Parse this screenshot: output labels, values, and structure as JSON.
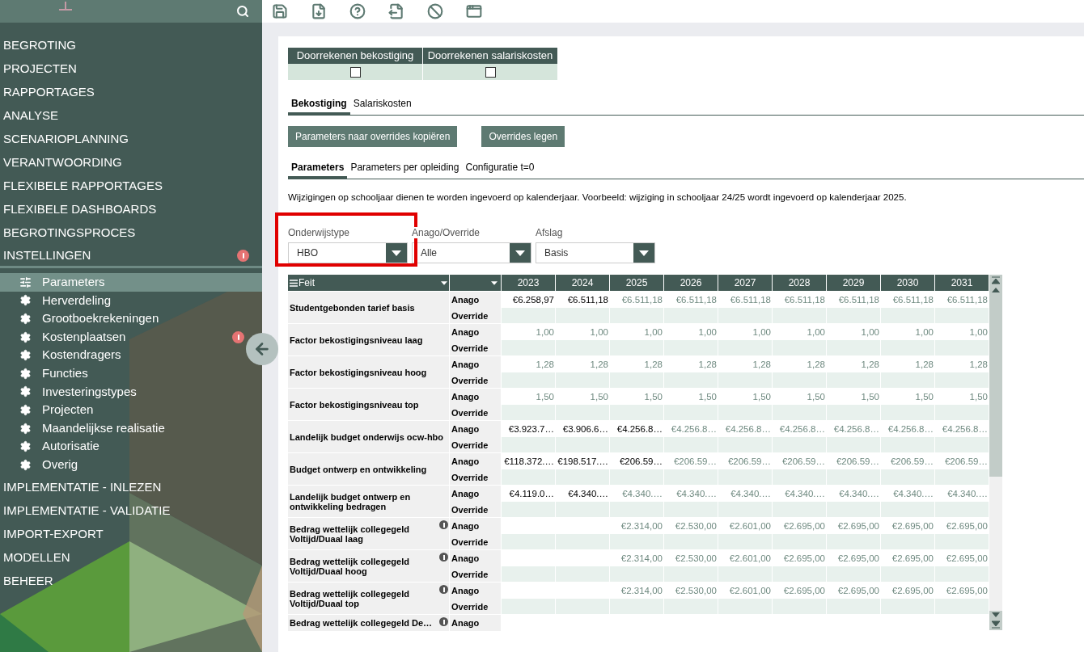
{
  "sidebar": {
    "items": [
      {
        "label": "BEGROTING",
        "selected": false,
        "alert": false
      },
      {
        "label": "PROJECTEN",
        "selected": false,
        "alert": false
      },
      {
        "label": "RAPPORTAGES",
        "selected": false,
        "alert": false
      },
      {
        "label": "ANALYSE",
        "selected": false,
        "alert": false
      },
      {
        "label": "SCENARIOPLANNING",
        "selected": false,
        "alert": false
      },
      {
        "label": "VERANTWOORDING",
        "selected": false,
        "alert": false
      },
      {
        "label": "FLEXIBELE RAPPORTAGES",
        "selected": false,
        "alert": false
      },
      {
        "label": "FLEXIBELE DASHBOARDS",
        "selected": false,
        "alert": false
      },
      {
        "label": "BEGROTINGSPROCES",
        "selected": false,
        "alert": false
      },
      {
        "label": "INSTELLINGEN",
        "selected": false,
        "alert": true,
        "expanded": true,
        "children": [
          {
            "label": "Parameters",
            "kind": "sliders",
            "selected": true,
            "alert": false
          },
          {
            "label": "Herverdeling",
            "kind": "gear",
            "selected": false,
            "alert": false
          },
          {
            "label": "Grootboekrekeningen",
            "kind": "gear",
            "selected": false,
            "alert": false
          },
          {
            "label": "Kostenplaatsen",
            "kind": "gear",
            "selected": false,
            "alert": true
          },
          {
            "label": "Kostendragers",
            "kind": "gear",
            "selected": false,
            "alert": false
          },
          {
            "label": "Functies",
            "kind": "gear",
            "selected": false,
            "alert": false
          },
          {
            "label": "Investeringstypes",
            "kind": "gear",
            "selected": false,
            "alert": false
          },
          {
            "label": "Projecten",
            "kind": "gear",
            "selected": false,
            "alert": false
          },
          {
            "label": "Maandelijkse realisatie",
            "kind": "gear",
            "selected": false,
            "alert": false
          },
          {
            "label": "Autorisatie",
            "kind": "gear",
            "selected": false,
            "alert": false
          },
          {
            "label": "Overig",
            "kind": "gear",
            "selected": false,
            "alert": false
          }
        ]
      },
      {
        "label": "IMPLEMENTATIE - INLEZEN",
        "selected": false,
        "alert": false
      },
      {
        "label": "IMPLEMENTATIE - VALIDATIE",
        "selected": false,
        "alert": false
      },
      {
        "label": "IMPORT-EXPORT",
        "selected": false,
        "alert": false
      },
      {
        "label": "MODELLEN",
        "selected": false,
        "alert": false
      },
      {
        "label": "BEHEER",
        "selected": false,
        "alert": false
      }
    ]
  },
  "toolbar": [
    {
      "kind": "save"
    },
    {
      "kind": "download"
    },
    {
      "kind": "help"
    },
    {
      "kind": "export"
    },
    {
      "kind": "ban"
    },
    {
      "kind": "window"
    }
  ],
  "calc_options": [
    {
      "label": "Doorrekenen bekostiging",
      "checked": false
    },
    {
      "label": "Doorrekenen salariskosten",
      "checked": false
    }
  ],
  "tabs": [
    {
      "label": "Bekostiging",
      "selected": true
    },
    {
      "label": "Salariskosten",
      "selected": false
    }
  ],
  "buttons": [
    "Parameters naar overrides kopiëren",
    "Overrides legen"
  ],
  "subtabs": [
    {
      "label": "Parameters",
      "selected": true
    },
    {
      "label": "Parameters per opleiding",
      "selected": false
    },
    {
      "label": "Configuratie t=0",
      "selected": false
    }
  ],
  "info_text": "Wijzigingen op schooljaar dienen te worden ingevoerd op kalenderjaar. Voorbeeld: wijziging in schooljaar 24/25 wordt ingevoerd op kalenderjaar 2025.",
  "filters": [
    {
      "label": "Onderwijstype",
      "value": "HBO",
      "highlighted": true
    },
    {
      "label": "Anago/Override",
      "value": "Alle",
      "highlighted": false
    },
    {
      "label": "Afslag",
      "value": "Basis",
      "highlighted": false
    }
  ],
  "table": {
    "columns": [
      "Feit",
      "2023",
      "2024",
      "2025",
      "2026",
      "2027",
      "2028",
      "2029",
      "2030",
      "2031"
    ],
    "rows": [
      {
        "feit": "Studentgebonden tarief basis",
        "info": false,
        "sub": [
          "Anago",
          "Override"
        ],
        "values": [
          {
            "text": "€6.258,97",
            "set": true
          },
          {
            "text": "€6.511,18",
            "set": true
          },
          {
            "text": "€6.511,18",
            "set": false
          },
          {
            "text": "€6.511,18",
            "set": false
          },
          {
            "text": "€6.511,18",
            "set": false
          },
          {
            "text": "€6.511,18",
            "set": false
          },
          {
            "text": "€6.511,18",
            "set": false
          },
          {
            "text": "€6.511,18",
            "set": false
          },
          {
            "text": "€6.511,18",
            "set": false
          }
        ]
      },
      {
        "feit": "Factor bekostigingsniveau laag",
        "info": false,
        "sub": [
          "Anago",
          "Override"
        ],
        "values": [
          {
            "text": "1,00",
            "set": false
          },
          {
            "text": "1,00",
            "set": false
          },
          {
            "text": "1,00",
            "set": false
          },
          {
            "text": "1,00",
            "set": false
          },
          {
            "text": "1,00",
            "set": false
          },
          {
            "text": "1,00",
            "set": false
          },
          {
            "text": "1,00",
            "set": false
          },
          {
            "text": "1,00",
            "set": false
          },
          {
            "text": "1,00",
            "set": false
          }
        ]
      },
      {
        "feit": "Factor bekostigingsniveau hoog",
        "info": false,
        "sub": [
          "Anago",
          "Override"
        ],
        "values": [
          {
            "text": "1,28",
            "set": false
          },
          {
            "text": "1,28",
            "set": false
          },
          {
            "text": "1,28",
            "set": false
          },
          {
            "text": "1,28",
            "set": false
          },
          {
            "text": "1,28",
            "set": false
          },
          {
            "text": "1,28",
            "set": false
          },
          {
            "text": "1,28",
            "set": false
          },
          {
            "text": "1,28",
            "set": false
          },
          {
            "text": "1,28",
            "set": false
          }
        ]
      },
      {
        "feit": "Factor bekostigingsniveau top",
        "info": false,
        "sub": [
          "Anago",
          "Override"
        ],
        "values": [
          {
            "text": "1,50",
            "set": false
          },
          {
            "text": "1,50",
            "set": false
          },
          {
            "text": "1,50",
            "set": false
          },
          {
            "text": "1,50",
            "set": false
          },
          {
            "text": "1,50",
            "set": false
          },
          {
            "text": "1,50",
            "set": false
          },
          {
            "text": "1,50",
            "set": false
          },
          {
            "text": "1,50",
            "set": false
          },
          {
            "text": "1,50",
            "set": false
          }
        ]
      },
      {
        "feit": "Landelijk budget onderwijs ocw-hbo",
        "info": false,
        "sub": [
          "Anago",
          "Override"
        ],
        "values": [
          {
            "text": "€3.923.7…",
            "set": true
          },
          {
            "text": "€3.906.6…",
            "set": true
          },
          {
            "text": "€4.256.8…",
            "set": true
          },
          {
            "text": "€4.256.8…",
            "set": false
          },
          {
            "text": "€4.256.8…",
            "set": false
          },
          {
            "text": "€4.256.8…",
            "set": false
          },
          {
            "text": "€4.256.8…",
            "set": false
          },
          {
            "text": "€4.256.8…",
            "set": false
          },
          {
            "text": "€4.256.8…",
            "set": false
          }
        ]
      },
      {
        "feit": "Budget ontwerp en ontwikkeling",
        "info": false,
        "sub": [
          "Anago",
          "Override"
        ],
        "values": [
          {
            "text": "€118.372.…",
            "set": true
          },
          {
            "text": "€198.517.…",
            "set": true
          },
          {
            "text": "€206.59…",
            "set": true
          },
          {
            "text": "€206.59…",
            "set": false
          },
          {
            "text": "€206.59…",
            "set": false
          },
          {
            "text": "€206.59…",
            "set": false
          },
          {
            "text": "€206.59…",
            "set": false
          },
          {
            "text": "€206.59…",
            "set": false
          },
          {
            "text": "€206.59…",
            "set": false
          }
        ]
      },
      {
        "feit": "Landelijk budget ontwerp en ontwikkeling bedragen",
        "info": false,
        "sub": [
          "Anago",
          "Override"
        ],
        "values": [
          {
            "text": "€4.119.0…",
            "set": true
          },
          {
            "text": "€4.340.…",
            "set": true
          },
          {
            "text": "€4.340.…",
            "set": false
          },
          {
            "text": "€4.340.…",
            "set": false
          },
          {
            "text": "€4.340.…",
            "set": false
          },
          {
            "text": "€4.340.…",
            "set": false
          },
          {
            "text": "€4.340.…",
            "set": false
          },
          {
            "text": "€4.340.…",
            "set": false
          },
          {
            "text": "€4.340.…",
            "set": false
          }
        ]
      },
      {
        "feit": "Bedrag wettelijk collegegeld Voltijd/Duaal laag",
        "info": true,
        "sub": [
          "Anago",
          "Override"
        ],
        "values": [
          {
            "kind": "empty"
          },
          {
            "kind": "empty"
          },
          {
            "text": "€2.314,00",
            "set": false
          },
          {
            "text": "€2.530,00",
            "set": false
          },
          {
            "text": "€2.601,00",
            "set": false
          },
          {
            "text": "€2.695,00",
            "set": false
          },
          {
            "text": "€2.695,00",
            "set": false
          },
          {
            "text": "€2.695,00",
            "set": false
          },
          {
            "text": "€2.695,00",
            "set": false
          }
        ]
      },
      {
        "feit": "Bedrag wettelijk collegegeld Voltijd/Duaal hoog",
        "info": true,
        "sub": [
          "Anago",
          "Override"
        ],
        "values": [
          {
            "kind": "empty"
          },
          {
            "kind": "empty"
          },
          {
            "text": "€2.314,00",
            "set": false
          },
          {
            "text": "€2.530,00",
            "set": false
          },
          {
            "text": "€2.601,00",
            "set": false
          },
          {
            "text": "€2.695,00",
            "set": false
          },
          {
            "text": "€2.695,00",
            "set": false
          },
          {
            "text": "€2.695,00",
            "set": false
          },
          {
            "text": "€2.695,00",
            "set": false
          }
        ]
      },
      {
        "feit": "Bedrag wettelijk collegegeld Voltijd/Duaal top",
        "info": true,
        "sub": [
          "Anago",
          "Override"
        ],
        "values": [
          {
            "kind": "empty"
          },
          {
            "kind": "empty"
          },
          {
            "text": "€2.314,00",
            "set": false
          },
          {
            "text": "€2.530,00",
            "set": false
          },
          {
            "text": "€2.601,00",
            "set": false
          },
          {
            "text": "€2.695,00",
            "set": false
          },
          {
            "text": "€2.695,00",
            "set": false
          },
          {
            "text": "€2.695,00",
            "set": false
          },
          {
            "text": "€2.695,00",
            "set": false
          }
        ]
      },
      {
        "feit": "Bedrag wettelijk collegegeld De…",
        "info": true,
        "sub": [
          "Anago"
        ],
        "values": []
      }
    ]
  }
}
